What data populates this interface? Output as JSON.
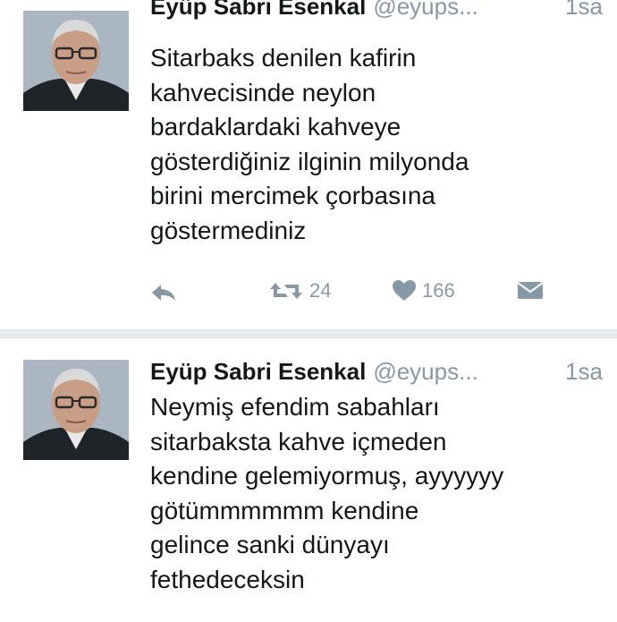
{
  "tweets": [
    {
      "author_name": "Eyüp Sabri Esenkal",
      "handle": "@eyups...",
      "time": "1sa",
      "lines": [
        "Sitarbaks denilen kafirin",
        "kahvecisinde neylon",
        "bardaklardaki kahveye",
        "gösterdiğiniz ilginin milyonda",
        "birini mercimek çorbasına",
        "göstermediniz"
      ],
      "retweets": "24",
      "likes": "166",
      "icons": [
        "reply-icon",
        "retweet-icon",
        "heart-icon",
        "envelope-icon"
      ]
    },
    {
      "author_name": "Eyüp Sabri Esenkal",
      "handle": "@eyups...",
      "time": "1sa",
      "lines": [
        "Neymiş efendim sabahları",
        "sitarbaksta kahve içmeden",
        "kendine gelemiyormuş, ayyyyyy",
        "götümmmmmm kendine",
        "gelince sanki dünyayı",
        "fethedeceksin"
      ]
    }
  ],
  "colors": {
    "text": "#14171a",
    "muted": "#8899a6",
    "separator": "#e9edf1"
  }
}
